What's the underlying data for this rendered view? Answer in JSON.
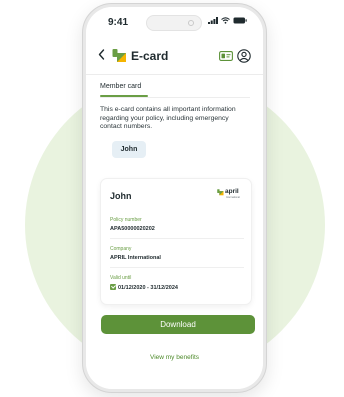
{
  "status": {
    "time": "9:41"
  },
  "header": {
    "title": "E-card"
  },
  "tab": {
    "label": "Member card"
  },
  "description": "This e-card contains all important information regarding your policy, including emergency contact numbers.",
  "member_chip": "John",
  "ecard": {
    "holder": "John",
    "brand": {
      "name": "april",
      "tagline": "International"
    },
    "fields": [
      {
        "label": "Policy number",
        "value": "APA50000020202"
      },
      {
        "label": "Company",
        "value": "APRIL International"
      },
      {
        "label": "Valid until",
        "value": "01/12/2020 - 31/12/2024"
      }
    ]
  },
  "actions": {
    "download": "Download",
    "benefits": "View my benefits"
  },
  "colors": {
    "accent": "#5d9239",
    "accent_text": "#6a9e45",
    "background_circle": "#e9f3df"
  },
  "icons": [
    "back-chevron-icon",
    "april-logo-icon",
    "id-card-icon",
    "user-circle-icon",
    "signal-icon",
    "wifi-icon",
    "battery-icon",
    "check-icon"
  ]
}
